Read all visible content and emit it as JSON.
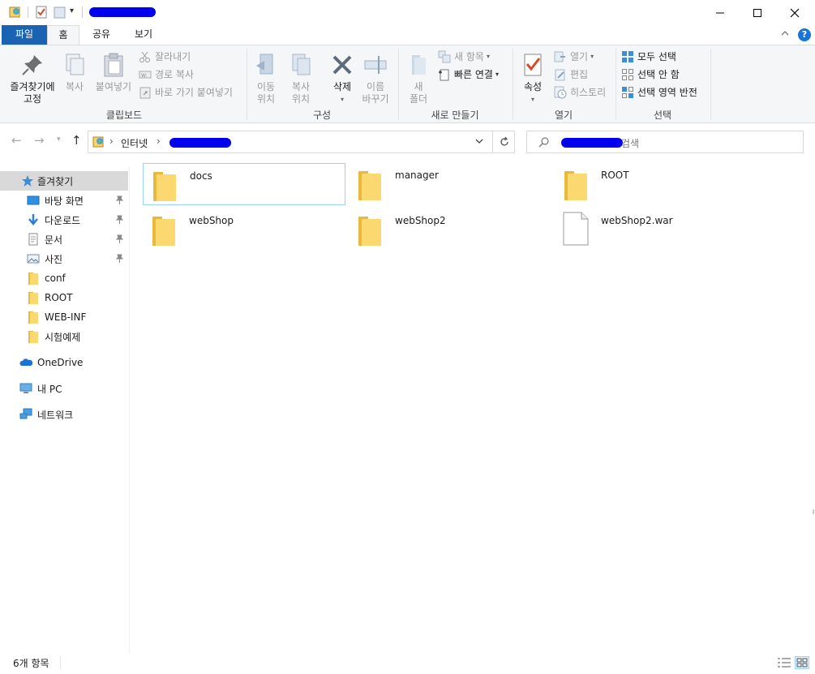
{
  "quick_access": {
    "properties_icon": "properties-icon",
    "new_folder_icon": "new-folder-icon",
    "dropdown": "▾"
  },
  "window": {
    "minimize": "—",
    "maximize": "☐",
    "close": "✕"
  },
  "tabs": {
    "file": "파일",
    "home": "홈",
    "share": "공유",
    "view": "보기"
  },
  "ribbon": {
    "clipboard": {
      "pin_label": "즐겨찾기에\n고정",
      "copy": "복사",
      "paste": "붙여넣기",
      "cut": "잘라내기",
      "copy_path": "경로 복사",
      "paste_shortcut": "바로 가기 붙여넣기",
      "group": "클립보드"
    },
    "organize": {
      "move_to": "이동\n위치",
      "copy_to": "복사\n위치",
      "delete": "삭제",
      "rename": "이름\n바꾸기",
      "group": "구성"
    },
    "new": {
      "new_folder": "새\n폴더",
      "new_item": "새 항목",
      "easy_access": "빠른 연결",
      "group": "새로 만들기"
    },
    "open": {
      "properties": "속성",
      "open": "열기",
      "edit": "편집",
      "history": "히스토리",
      "group": "열기"
    },
    "select": {
      "select_all": "모두 선택",
      "select_none": "선택 안 함",
      "invert": "선택 영역 반전",
      "group": "선택"
    }
  },
  "address": {
    "crumb_1": "인터넷",
    "separator": "›",
    "search_suffix": "검색"
  },
  "nav": {
    "favorites": "즐겨찾기",
    "desktop": "바탕 화면",
    "downloads": "다운로드",
    "documents": "문서",
    "pictures": "사진",
    "conf": "conf",
    "root": "ROOT",
    "webinf": "WEB-INF",
    "exam": "시험예제",
    "onedrive": "OneDrive",
    "mypc": "내 PC",
    "network": "네트워크"
  },
  "files": [
    {
      "name": "docs",
      "type": "folder"
    },
    {
      "name": "manager",
      "type": "folder"
    },
    {
      "name": "ROOT",
      "type": "folder"
    },
    {
      "name": "webShop",
      "type": "folder"
    },
    {
      "name": "webShop2",
      "type": "folder"
    },
    {
      "name": "webShop2.war",
      "type": "file"
    }
  ],
  "status": {
    "item_count": "6개 항목"
  },
  "colors": {
    "accent": "#1a62b2",
    "folder_front": "#fcd870",
    "folder_back": "#e8b93a",
    "selection": "#d9d9d9",
    "focus_border": "#99d1ff",
    "redaction": "#0000ee"
  }
}
